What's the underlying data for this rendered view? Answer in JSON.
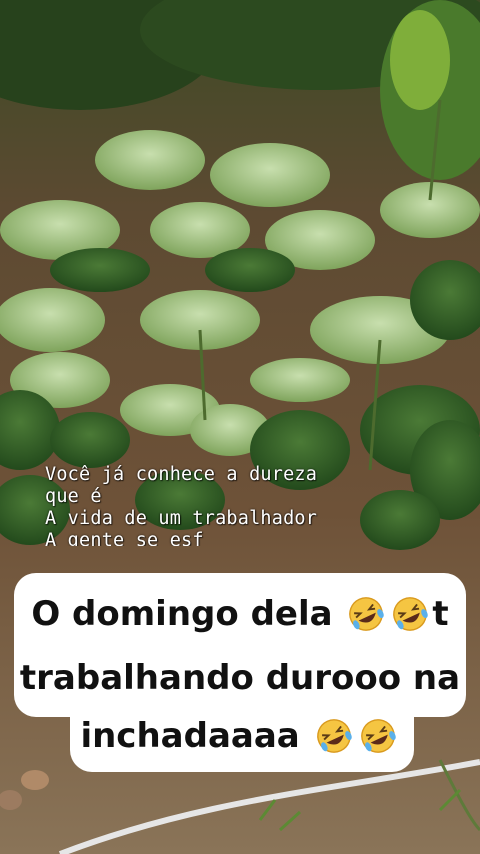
{
  "overlay_text": {
    "lyrics": [
      "Você já conhece a dureza",
      "que é",
      "A vida de um trabalhador",
      "A gente se esf"
    ]
  },
  "caption": {
    "line1": "O domingo dela",
    "line1_end": "t",
    "line2": "trabalhando durooo na",
    "line3": "inchadaaaa"
  },
  "emoji": {
    "name": "rolling-on-the-floor-laughing-emoji",
    "color": "#f5c542"
  }
}
